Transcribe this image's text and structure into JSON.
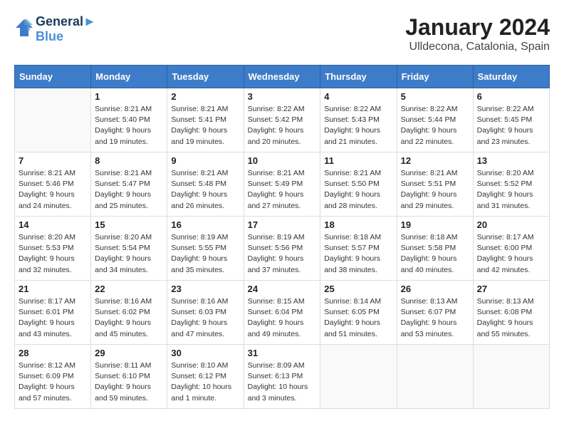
{
  "header": {
    "logo_line1": "General",
    "logo_line2": "Blue",
    "month_title": "January 2024",
    "location": "Ulldecona, Catalonia, Spain"
  },
  "weekdays": [
    "Sunday",
    "Monday",
    "Tuesday",
    "Wednesday",
    "Thursday",
    "Friday",
    "Saturday"
  ],
  "weeks": [
    [
      {
        "day": "",
        "info": ""
      },
      {
        "day": "1",
        "info": "Sunrise: 8:21 AM\nSunset: 5:40 PM\nDaylight: 9 hours\nand 19 minutes."
      },
      {
        "day": "2",
        "info": "Sunrise: 8:21 AM\nSunset: 5:41 PM\nDaylight: 9 hours\nand 19 minutes."
      },
      {
        "day": "3",
        "info": "Sunrise: 8:22 AM\nSunset: 5:42 PM\nDaylight: 9 hours\nand 20 minutes."
      },
      {
        "day": "4",
        "info": "Sunrise: 8:22 AM\nSunset: 5:43 PM\nDaylight: 9 hours\nand 21 minutes."
      },
      {
        "day": "5",
        "info": "Sunrise: 8:22 AM\nSunset: 5:44 PM\nDaylight: 9 hours\nand 22 minutes."
      },
      {
        "day": "6",
        "info": "Sunrise: 8:22 AM\nSunset: 5:45 PM\nDaylight: 9 hours\nand 23 minutes."
      }
    ],
    [
      {
        "day": "7",
        "info": "Sunrise: 8:21 AM\nSunset: 5:46 PM\nDaylight: 9 hours\nand 24 minutes."
      },
      {
        "day": "8",
        "info": "Sunrise: 8:21 AM\nSunset: 5:47 PM\nDaylight: 9 hours\nand 25 minutes."
      },
      {
        "day": "9",
        "info": "Sunrise: 8:21 AM\nSunset: 5:48 PM\nDaylight: 9 hours\nand 26 minutes."
      },
      {
        "day": "10",
        "info": "Sunrise: 8:21 AM\nSunset: 5:49 PM\nDaylight: 9 hours\nand 27 minutes."
      },
      {
        "day": "11",
        "info": "Sunrise: 8:21 AM\nSunset: 5:50 PM\nDaylight: 9 hours\nand 28 minutes."
      },
      {
        "day": "12",
        "info": "Sunrise: 8:21 AM\nSunset: 5:51 PM\nDaylight: 9 hours\nand 29 minutes."
      },
      {
        "day": "13",
        "info": "Sunrise: 8:20 AM\nSunset: 5:52 PM\nDaylight: 9 hours\nand 31 minutes."
      }
    ],
    [
      {
        "day": "14",
        "info": "Sunrise: 8:20 AM\nSunset: 5:53 PM\nDaylight: 9 hours\nand 32 minutes."
      },
      {
        "day": "15",
        "info": "Sunrise: 8:20 AM\nSunset: 5:54 PM\nDaylight: 9 hours\nand 34 minutes."
      },
      {
        "day": "16",
        "info": "Sunrise: 8:19 AM\nSunset: 5:55 PM\nDaylight: 9 hours\nand 35 minutes."
      },
      {
        "day": "17",
        "info": "Sunrise: 8:19 AM\nSunset: 5:56 PM\nDaylight: 9 hours\nand 37 minutes."
      },
      {
        "day": "18",
        "info": "Sunrise: 8:18 AM\nSunset: 5:57 PM\nDaylight: 9 hours\nand 38 minutes."
      },
      {
        "day": "19",
        "info": "Sunrise: 8:18 AM\nSunset: 5:58 PM\nDaylight: 9 hours\nand 40 minutes."
      },
      {
        "day": "20",
        "info": "Sunrise: 8:17 AM\nSunset: 6:00 PM\nDaylight: 9 hours\nand 42 minutes."
      }
    ],
    [
      {
        "day": "21",
        "info": "Sunrise: 8:17 AM\nSunset: 6:01 PM\nDaylight: 9 hours\nand 43 minutes."
      },
      {
        "day": "22",
        "info": "Sunrise: 8:16 AM\nSunset: 6:02 PM\nDaylight: 9 hours\nand 45 minutes."
      },
      {
        "day": "23",
        "info": "Sunrise: 8:16 AM\nSunset: 6:03 PM\nDaylight: 9 hours\nand 47 minutes."
      },
      {
        "day": "24",
        "info": "Sunrise: 8:15 AM\nSunset: 6:04 PM\nDaylight: 9 hours\nand 49 minutes."
      },
      {
        "day": "25",
        "info": "Sunrise: 8:14 AM\nSunset: 6:05 PM\nDaylight: 9 hours\nand 51 minutes."
      },
      {
        "day": "26",
        "info": "Sunrise: 8:13 AM\nSunset: 6:07 PM\nDaylight: 9 hours\nand 53 minutes."
      },
      {
        "day": "27",
        "info": "Sunrise: 8:13 AM\nSunset: 6:08 PM\nDaylight: 9 hours\nand 55 minutes."
      }
    ],
    [
      {
        "day": "28",
        "info": "Sunrise: 8:12 AM\nSunset: 6:09 PM\nDaylight: 9 hours\nand 57 minutes."
      },
      {
        "day": "29",
        "info": "Sunrise: 8:11 AM\nSunset: 6:10 PM\nDaylight: 9 hours\nand 59 minutes."
      },
      {
        "day": "30",
        "info": "Sunrise: 8:10 AM\nSunset: 6:12 PM\nDaylight: 10 hours\nand 1 minute."
      },
      {
        "day": "31",
        "info": "Sunrise: 8:09 AM\nSunset: 6:13 PM\nDaylight: 10 hours\nand 3 minutes."
      },
      {
        "day": "",
        "info": ""
      },
      {
        "day": "",
        "info": ""
      },
      {
        "day": "",
        "info": ""
      }
    ]
  ]
}
